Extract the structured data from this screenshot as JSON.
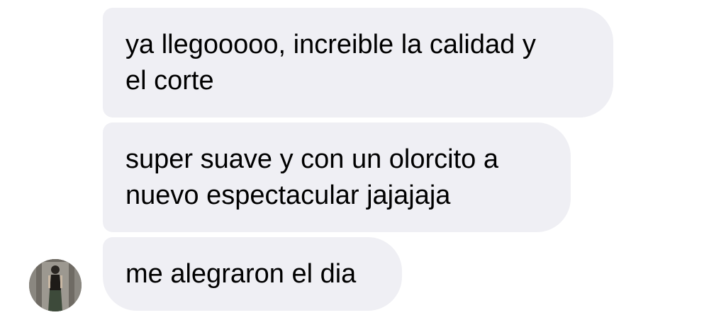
{
  "conversation": {
    "messages": [
      {
        "text": "ya llegooooo, increible la calidad y\nel corte"
      },
      {
        "text": "super suave y con un olorcito a\nnuevo espectacular jajajaja"
      },
      {
        "text": "me alegraron el dia"
      }
    ],
    "sender": {
      "avatar_icon": "profile-photo-icon"
    }
  }
}
